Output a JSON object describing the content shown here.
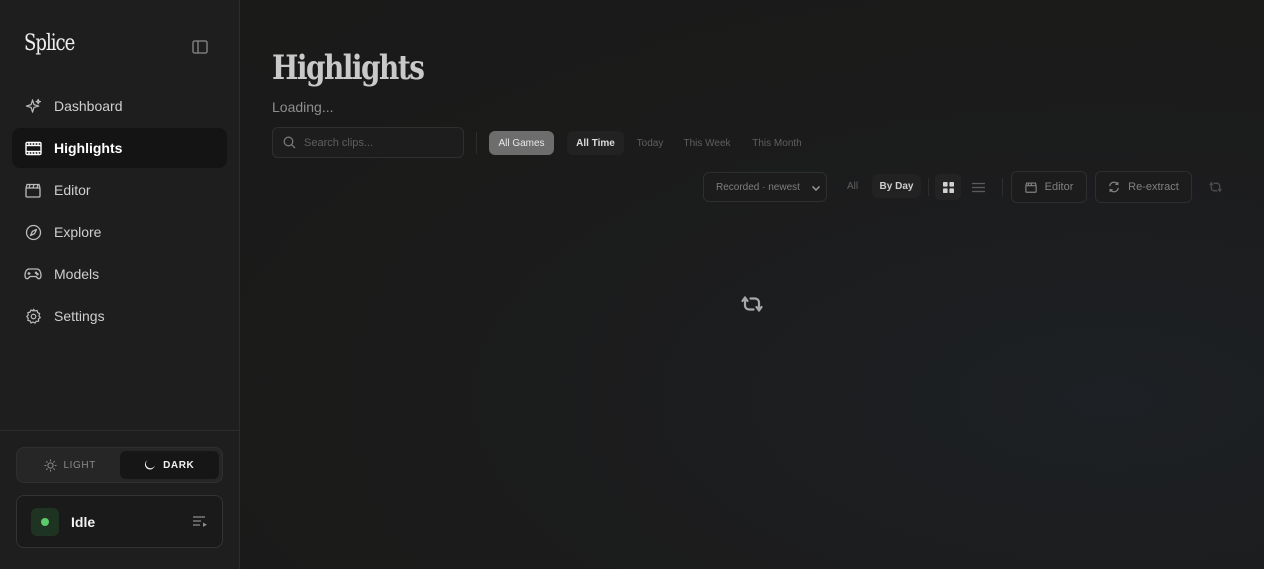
{
  "app": {
    "name": "Splice"
  },
  "sidebar": {
    "items": [
      {
        "label": "Dashboard",
        "icon": "sparkle-icon",
        "active": false
      },
      {
        "label": "Highlights",
        "icon": "film-strip-icon",
        "active": true
      },
      {
        "label": "Editor",
        "icon": "clapperboard-icon",
        "active": false
      },
      {
        "label": "Explore",
        "icon": "compass-icon",
        "active": false
      },
      {
        "label": "Models",
        "icon": "gamepad-icon",
        "active": false
      },
      {
        "label": "Settings",
        "icon": "gear-icon",
        "active": false
      }
    ],
    "theme": {
      "light_label": "LIGHT",
      "dark_label": "DARK",
      "selected": "dark"
    },
    "status": {
      "label": "Idle",
      "color": "#5ecb6a"
    }
  },
  "main": {
    "title": "Highlights",
    "loading_text": "Loading...",
    "search": {
      "placeholder": "Search clips..."
    },
    "game_filter": {
      "label": "All Games"
    },
    "time_filters": [
      "All Time",
      "Today",
      "This Week",
      "This Month"
    ],
    "time_filter_selected": "All Time",
    "sort": {
      "value": "Recorded · newest"
    },
    "group_filters": [
      "All",
      "By Day"
    ],
    "group_selected": "By Day",
    "view_mode": "grid",
    "buttons": {
      "editor": "Editor",
      "reextract": "Re-extract"
    }
  },
  "colors": {
    "background": "#1b1b1b",
    "sidebar": "#1e1e1e",
    "accent_status": "#5ecb6a"
  }
}
